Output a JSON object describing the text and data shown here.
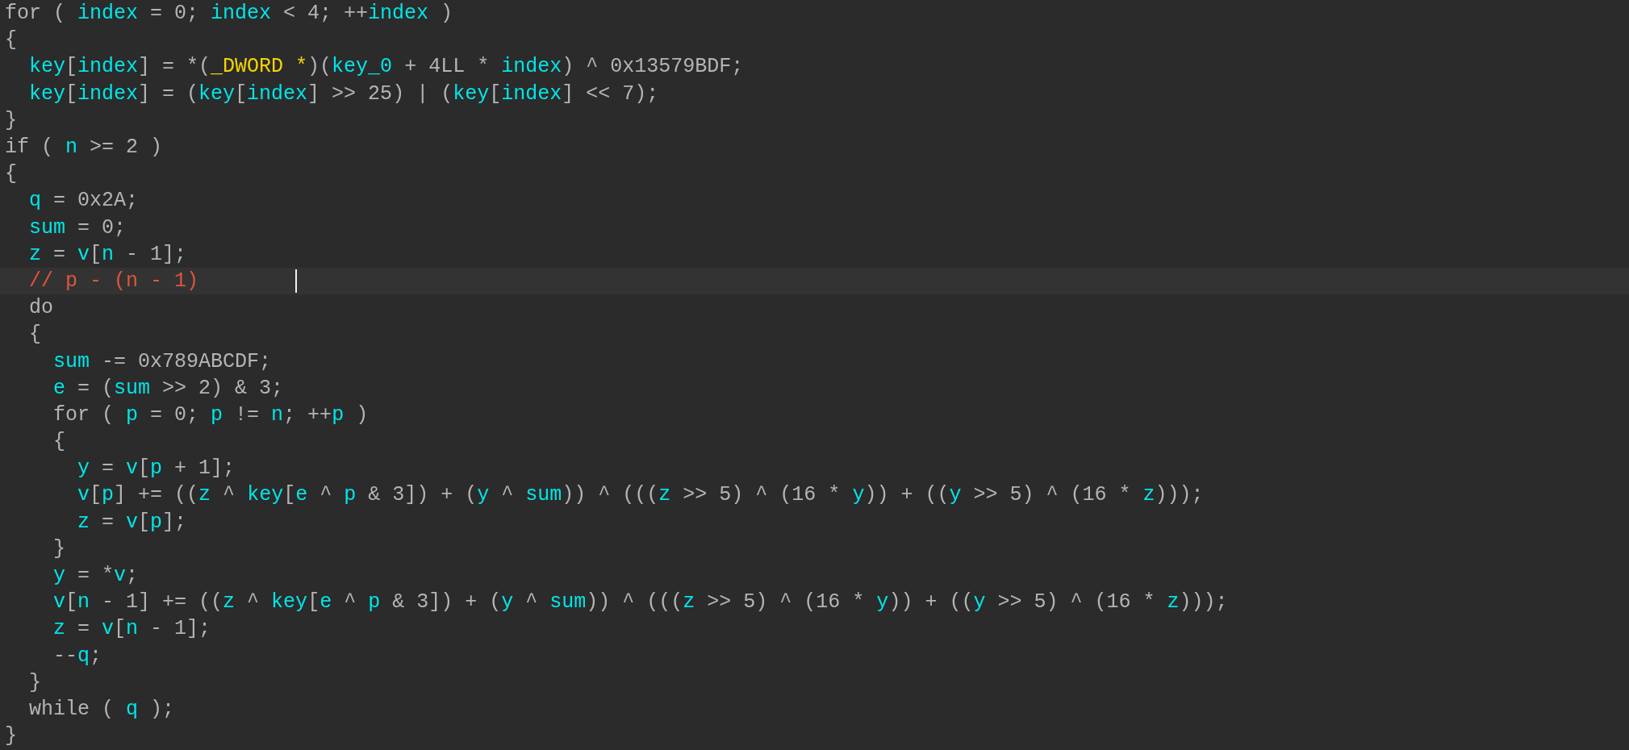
{
  "editor": {
    "lines": [
      {
        "current": false,
        "segments": [
          {
            "kind": "plain",
            "text": "for ( "
          },
          {
            "kind": "id",
            "text": "index"
          },
          {
            "kind": "plain",
            "text": " = 0; "
          },
          {
            "kind": "id",
            "text": "index"
          },
          {
            "kind": "plain",
            "text": " < 4; ++"
          },
          {
            "kind": "id",
            "text": "index"
          },
          {
            "kind": "plain",
            "text": " )"
          }
        ]
      },
      {
        "current": false,
        "segments": [
          {
            "kind": "plain",
            "text": "{"
          }
        ]
      },
      {
        "current": false,
        "segments": [
          {
            "kind": "id",
            "text": "  key"
          },
          {
            "kind": "plain",
            "text": "["
          },
          {
            "kind": "id",
            "text": "index"
          },
          {
            "kind": "plain",
            "text": "] = *("
          },
          {
            "kind": "type",
            "text": "_DWORD *"
          },
          {
            "kind": "plain",
            "text": ")("
          },
          {
            "kind": "id",
            "text": "key_0"
          },
          {
            "kind": "plain",
            "text": " + 4LL * "
          },
          {
            "kind": "id",
            "text": "index"
          },
          {
            "kind": "plain",
            "text": ") ^ 0x13579BDF;"
          }
        ]
      },
      {
        "current": false,
        "segments": [
          {
            "kind": "id",
            "text": "  key"
          },
          {
            "kind": "plain",
            "text": "["
          },
          {
            "kind": "id",
            "text": "index"
          },
          {
            "kind": "plain",
            "text": "] = ("
          },
          {
            "kind": "id",
            "text": "key"
          },
          {
            "kind": "plain",
            "text": "["
          },
          {
            "kind": "id",
            "text": "index"
          },
          {
            "kind": "plain",
            "text": "] >> 25) | ("
          },
          {
            "kind": "id",
            "text": "key"
          },
          {
            "kind": "plain",
            "text": "["
          },
          {
            "kind": "id",
            "text": "index"
          },
          {
            "kind": "plain",
            "text": "] << 7);"
          }
        ]
      },
      {
        "current": false,
        "segments": [
          {
            "kind": "plain",
            "text": "}"
          }
        ]
      },
      {
        "current": false,
        "segments": [
          {
            "kind": "plain",
            "text": "if ( "
          },
          {
            "kind": "id",
            "text": "n"
          },
          {
            "kind": "plain",
            "text": " >= 2 )"
          }
        ]
      },
      {
        "current": false,
        "segments": [
          {
            "kind": "plain",
            "text": "{"
          }
        ]
      },
      {
        "current": false,
        "segments": [
          {
            "kind": "id",
            "text": "  q"
          },
          {
            "kind": "plain",
            "text": " = 0x2A;"
          }
        ]
      },
      {
        "current": false,
        "segments": [
          {
            "kind": "id",
            "text": "  sum"
          },
          {
            "kind": "plain",
            "text": " = 0;"
          }
        ]
      },
      {
        "current": false,
        "segments": [
          {
            "kind": "id",
            "text": "  z"
          },
          {
            "kind": "plain",
            "text": " = "
          },
          {
            "kind": "id",
            "text": "v"
          },
          {
            "kind": "plain",
            "text": "["
          },
          {
            "kind": "id",
            "text": "n"
          },
          {
            "kind": "plain",
            "text": " - 1];"
          }
        ]
      },
      {
        "current": true,
        "segments": [
          {
            "kind": "comment",
            "text": "  // p - (n - 1)"
          }
        ]
      },
      {
        "current": false,
        "segments": [
          {
            "kind": "plain",
            "text": "  do"
          }
        ]
      },
      {
        "current": false,
        "segments": [
          {
            "kind": "plain",
            "text": "  {"
          }
        ]
      },
      {
        "current": false,
        "segments": [
          {
            "kind": "id",
            "text": "    sum"
          },
          {
            "kind": "plain",
            "text": " -= 0x789ABCDF;"
          }
        ]
      },
      {
        "current": false,
        "segments": [
          {
            "kind": "id",
            "text": "    e"
          },
          {
            "kind": "plain",
            "text": " = ("
          },
          {
            "kind": "id",
            "text": "sum"
          },
          {
            "kind": "plain",
            "text": " >> 2) & 3;"
          }
        ]
      },
      {
        "current": false,
        "segments": [
          {
            "kind": "plain",
            "text": "    for ( "
          },
          {
            "kind": "id",
            "text": "p"
          },
          {
            "kind": "plain",
            "text": " = 0; "
          },
          {
            "kind": "id",
            "text": "p"
          },
          {
            "kind": "plain",
            "text": " != "
          },
          {
            "kind": "id",
            "text": "n"
          },
          {
            "kind": "plain",
            "text": "; ++"
          },
          {
            "kind": "id",
            "text": "p"
          },
          {
            "kind": "plain",
            "text": " )"
          }
        ]
      },
      {
        "current": false,
        "segments": [
          {
            "kind": "plain",
            "text": "    {"
          }
        ]
      },
      {
        "current": false,
        "segments": [
          {
            "kind": "id",
            "text": "      y"
          },
          {
            "kind": "plain",
            "text": " = "
          },
          {
            "kind": "id",
            "text": "v"
          },
          {
            "kind": "plain",
            "text": "["
          },
          {
            "kind": "id",
            "text": "p"
          },
          {
            "kind": "plain",
            "text": " + 1];"
          }
        ]
      },
      {
        "current": false,
        "segments": [
          {
            "kind": "id",
            "text": "      v"
          },
          {
            "kind": "plain",
            "text": "["
          },
          {
            "kind": "id",
            "text": "p"
          },
          {
            "kind": "plain",
            "text": "] += (("
          },
          {
            "kind": "id",
            "text": "z"
          },
          {
            "kind": "plain",
            "text": " ^ "
          },
          {
            "kind": "id",
            "text": "key"
          },
          {
            "kind": "plain",
            "text": "["
          },
          {
            "kind": "id",
            "text": "e"
          },
          {
            "kind": "plain",
            "text": " ^ "
          },
          {
            "kind": "id",
            "text": "p"
          },
          {
            "kind": "plain",
            "text": " & 3]) + ("
          },
          {
            "kind": "id",
            "text": "y"
          },
          {
            "kind": "plain",
            "text": " ^ "
          },
          {
            "kind": "id",
            "text": "sum"
          },
          {
            "kind": "plain",
            "text": ")) ^ ((("
          },
          {
            "kind": "id",
            "text": "z"
          },
          {
            "kind": "plain",
            "text": " >> 5) ^ (16 * "
          },
          {
            "kind": "id",
            "text": "y"
          },
          {
            "kind": "plain",
            "text": ")) + (("
          },
          {
            "kind": "id",
            "text": "y"
          },
          {
            "kind": "plain",
            "text": " >> 5) ^ (16 * "
          },
          {
            "kind": "id",
            "text": "z"
          },
          {
            "kind": "plain",
            "text": ")));"
          }
        ]
      },
      {
        "current": false,
        "segments": [
          {
            "kind": "id",
            "text": "      z"
          },
          {
            "kind": "plain",
            "text": " = "
          },
          {
            "kind": "id",
            "text": "v"
          },
          {
            "kind": "plain",
            "text": "["
          },
          {
            "kind": "id",
            "text": "p"
          },
          {
            "kind": "plain",
            "text": "];"
          }
        ]
      },
      {
        "current": false,
        "segments": [
          {
            "kind": "plain",
            "text": "    }"
          }
        ]
      },
      {
        "current": false,
        "segments": [
          {
            "kind": "id",
            "text": "    y"
          },
          {
            "kind": "plain",
            "text": " = *"
          },
          {
            "kind": "id",
            "text": "v"
          },
          {
            "kind": "plain",
            "text": ";"
          }
        ]
      },
      {
        "current": false,
        "segments": [
          {
            "kind": "id",
            "text": "    v"
          },
          {
            "kind": "plain",
            "text": "["
          },
          {
            "kind": "id",
            "text": "n"
          },
          {
            "kind": "plain",
            "text": " - 1] += (("
          },
          {
            "kind": "id",
            "text": "z"
          },
          {
            "kind": "plain",
            "text": " ^ "
          },
          {
            "kind": "id",
            "text": "key"
          },
          {
            "kind": "plain",
            "text": "["
          },
          {
            "kind": "id",
            "text": "e"
          },
          {
            "kind": "plain",
            "text": " ^ "
          },
          {
            "kind": "id",
            "text": "p"
          },
          {
            "kind": "plain",
            "text": " & 3]) + ("
          },
          {
            "kind": "id",
            "text": "y"
          },
          {
            "kind": "plain",
            "text": " ^ "
          },
          {
            "kind": "id",
            "text": "sum"
          },
          {
            "kind": "plain",
            "text": ")) ^ ((("
          },
          {
            "kind": "id",
            "text": "z"
          },
          {
            "kind": "plain",
            "text": " >> 5) ^ (16 * "
          },
          {
            "kind": "id",
            "text": "y"
          },
          {
            "kind": "plain",
            "text": ")) + (("
          },
          {
            "kind": "id",
            "text": "y"
          },
          {
            "kind": "plain",
            "text": " >> 5) ^ (16 * "
          },
          {
            "kind": "id",
            "text": "z"
          },
          {
            "kind": "plain",
            "text": ")));"
          }
        ]
      },
      {
        "current": false,
        "segments": [
          {
            "kind": "id",
            "text": "    z"
          },
          {
            "kind": "plain",
            "text": " = "
          },
          {
            "kind": "id",
            "text": "v"
          },
          {
            "kind": "plain",
            "text": "["
          },
          {
            "kind": "id",
            "text": "n"
          },
          {
            "kind": "plain",
            "text": " - 1];"
          }
        ]
      },
      {
        "current": false,
        "segments": [
          {
            "kind": "plain",
            "text": "    --"
          },
          {
            "kind": "id",
            "text": "q"
          },
          {
            "kind": "plain",
            "text": ";"
          }
        ]
      },
      {
        "current": false,
        "segments": [
          {
            "kind": "plain",
            "text": "  }"
          }
        ]
      },
      {
        "current": false,
        "segments": [
          {
            "kind": "plain",
            "text": "  while ( "
          },
          {
            "kind": "id",
            "text": "q"
          },
          {
            "kind": "plain",
            "text": " );"
          }
        ]
      },
      {
        "current": false,
        "segments": [
          {
            "kind": "plain",
            "text": "}"
          }
        ]
      }
    ]
  }
}
